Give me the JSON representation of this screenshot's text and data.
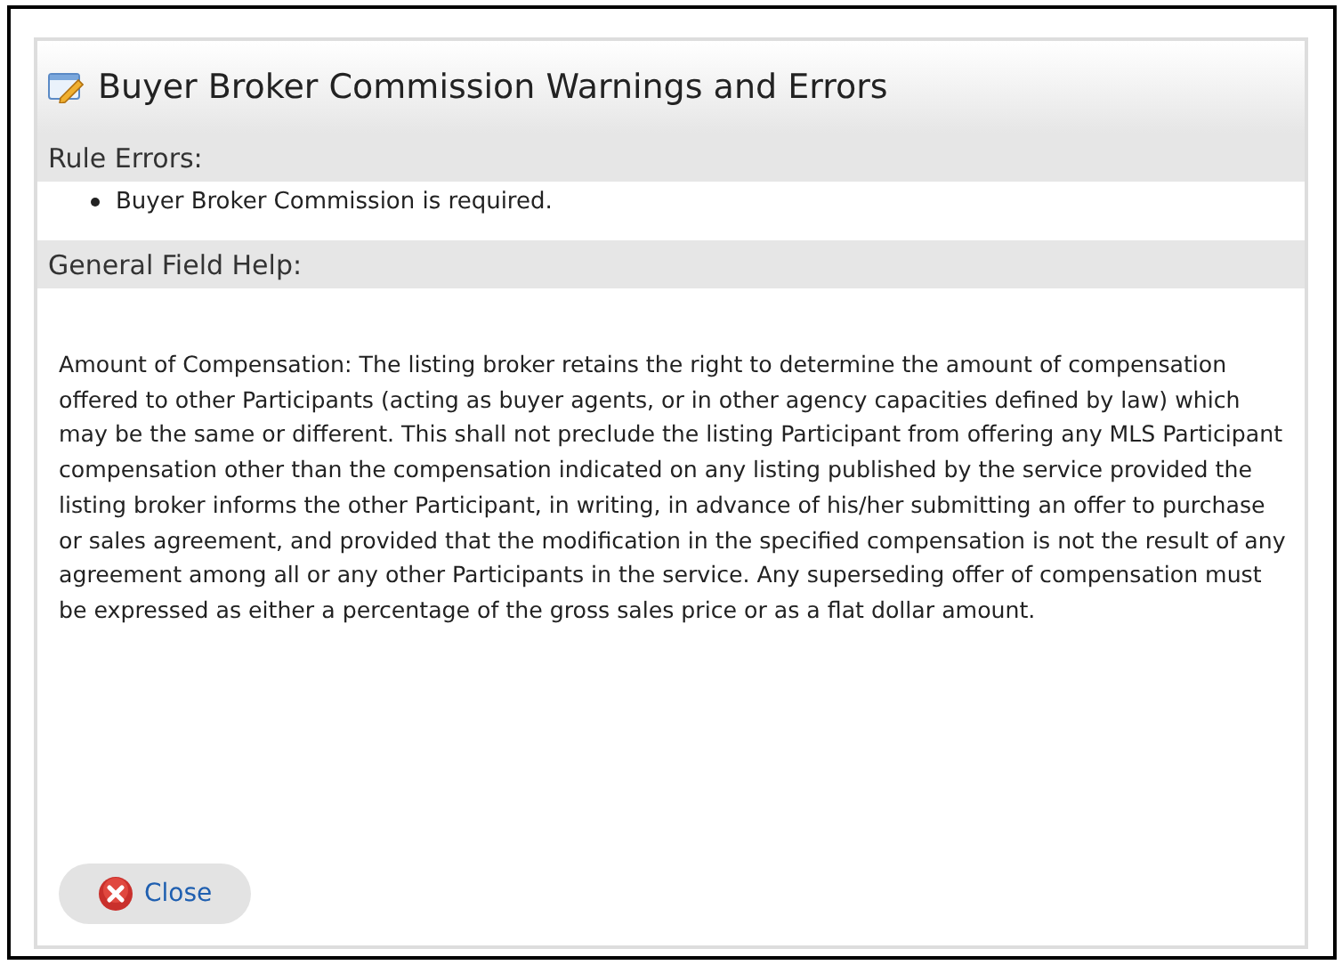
{
  "dialog": {
    "title": "Buyer Broker Commission Warnings and Errors"
  },
  "rule_errors": {
    "heading": "Rule Errors:",
    "items": [
      "Buyer Broker Commission is required."
    ]
  },
  "field_help": {
    "heading": "General Field Help:",
    "text": "Amount of Compensation: The listing broker retains the right to determine the amount of compensation offered to other Participants (acting as buyer agents, or in other agency capacities defined by law) which may be the same or different. This shall not preclude the listing Participant from offering any MLS Participant compensation other than the compensation indicated on any listing published by the service provided the listing broker informs the other Participant, in writing, in advance of his/her submitting an offer to purchase or sales agreement, and provided that the modification in the specified compensation is not the result of any agreement among all or any other Participants in the service. Any superseding offer of compensation must be expressed as either a percentage of the gross sales price or as a flat dollar amount."
  },
  "buttons": [
    {
      "label": "Close"
    }
  ]
}
